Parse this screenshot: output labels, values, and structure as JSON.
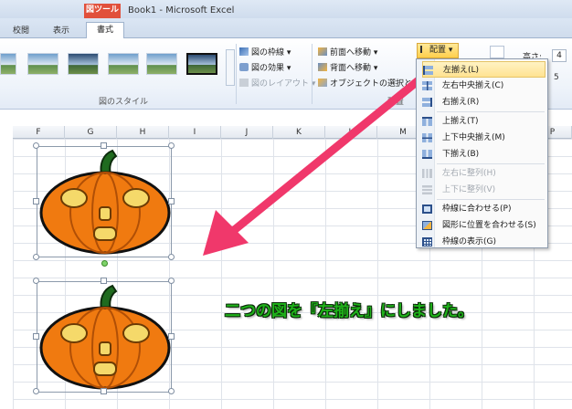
{
  "window": {
    "title": "Book1 - Microsoft Excel",
    "context_tab": "図ツール"
  },
  "tabs": [
    {
      "label": "校閲"
    },
    {
      "label": "表示"
    },
    {
      "label": "書式",
      "active": true
    }
  ],
  "ribbon": {
    "picture_styles_label": "図のスタイル",
    "border_label": "図の枠線",
    "effects_label": "図の効果",
    "layout_label": "図のレイアウト",
    "bring_forward": "前面へ移動",
    "send_backward": "背面へ移動",
    "selection_pane": "オブジェクトの選択と表示",
    "arrange_label": "配置",
    "align_button": "配置",
    "height_label": "高さ:",
    "height_value": "4",
    "width_value": "5"
  },
  "columns": [
    "F",
    "G",
    "H",
    "I",
    "J",
    "K",
    "L",
    "M",
    "N",
    "O",
    "P"
  ],
  "align_menu": {
    "items": [
      {
        "label": "左揃え(L)",
        "icon": "align-left-icon",
        "highlighted": true,
        "enabled": true
      },
      {
        "label": "左右中央揃え(C)",
        "icon": "align-center-icon",
        "enabled": true
      },
      {
        "label": "右揃え(R)",
        "icon": "align-right-icon",
        "enabled": true
      },
      {
        "label": "上揃え(T)",
        "icon": "align-top-icon",
        "enabled": true
      },
      {
        "label": "上下中央揃え(M)",
        "icon": "align-middle-icon",
        "enabled": true
      },
      {
        "label": "下揃え(B)",
        "icon": "align-bottom-icon",
        "enabled": true
      },
      {
        "label": "左右に整列(H)",
        "icon": "distribute-horizontal-icon",
        "enabled": false
      },
      {
        "label": "上下に整列(V)",
        "icon": "distribute-vertical-icon",
        "enabled": false
      },
      {
        "label": "枠線に合わせる(P)",
        "icon": "snap-to-grid-icon",
        "enabled": true
      },
      {
        "label": "図形に位置を合わせる(S)",
        "icon": "snap-to-shape-icon",
        "enabled": true
      },
      {
        "label": "枠線の表示(G)",
        "icon": "view-gridlines-icon",
        "enabled": true
      }
    ]
  },
  "caption": "二つの図を『左揃え』にしました。",
  "colors": {
    "caption_green": "#1fb31a",
    "arrow_pink": "#f0386b",
    "pumpkin_orange": "#f07a10",
    "highlight_yellow": "#ffe391"
  }
}
